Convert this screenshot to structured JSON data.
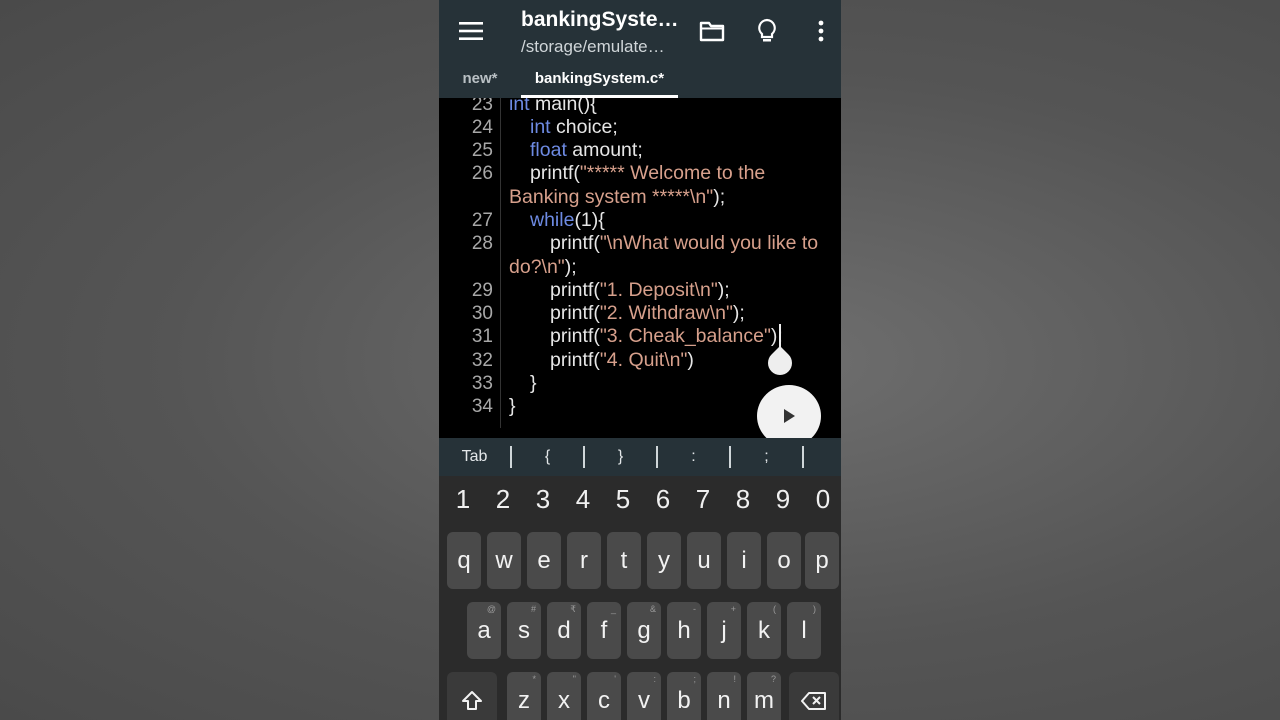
{
  "app": {
    "title": "bankingSyste…",
    "path": "/storage/emulate…",
    "tabs": [
      "new*",
      "bankingSystem.c*"
    ]
  },
  "editor": {
    "line_numbers": [
      "23",
      "24",
      "25",
      "26",
      "27",
      "28",
      "29",
      "30",
      "31",
      "32",
      "33",
      "34"
    ],
    "lines": {
      "l23_kw": "int",
      "l23_rest": " main(){",
      "l24_kw": "int",
      "l24_rest": " choice;",
      "l25_kw": "float",
      "l25_rest": " amount;",
      "l26_a": "printf(",
      "l26_str": "\"***** Welcome to the",
      "l26b_str": "Banking system *****\\n\"",
      "l26b_rest": ");",
      "l27_kw": "while",
      "l27_rest": "(1){",
      "l28_a": "printf(",
      "l28_str": "\"\\nWhat would you like to",
      "l28b_str": "do?\\n\"",
      "l28b_rest": ");",
      "l29_a": "printf(",
      "l29_str": "\"1. Deposit\\n\"",
      "l29_rest": ");",
      "l30_a": "printf(",
      "l30_str": "\"2. Withdraw\\n\"",
      "l30_rest": ");",
      "l31_a": "printf(",
      "l31_str": "\"3. Cheak_balance\"",
      "l31_rest": ");",
      "l32_a": "printf(",
      "l32_str": "\"4. Quit\\n\"",
      "l32_rest": ")",
      "l33": "}",
      "l34": "}"
    }
  },
  "symbols": [
    "Tab",
    "{",
    "}",
    ":",
    ";"
  ],
  "keyboard": {
    "numbers": [
      "1",
      "2",
      "3",
      "4",
      "5",
      "6",
      "7",
      "8",
      "9",
      "0"
    ],
    "row1": [
      "q",
      "w",
      "e",
      "r",
      "t",
      "y",
      "u",
      "i",
      "o",
      "p"
    ],
    "row2": [
      "a",
      "s",
      "d",
      "f",
      "g",
      "h",
      "j",
      "k",
      "l"
    ],
    "row2_hints": [
      "@",
      "#",
      "₹",
      "_",
      "&",
      "-",
      "+",
      "(",
      ")"
    ],
    "row3": [
      "z",
      "x",
      "c",
      "v",
      "b",
      "n",
      "m"
    ],
    "row3_hints": [
      "*",
      "\"",
      "'",
      ":",
      ";",
      "!",
      "?"
    ]
  },
  "colors": {
    "appbar": "#263238",
    "keyword": "#6d8ae2",
    "string": "#d7a08c"
  }
}
